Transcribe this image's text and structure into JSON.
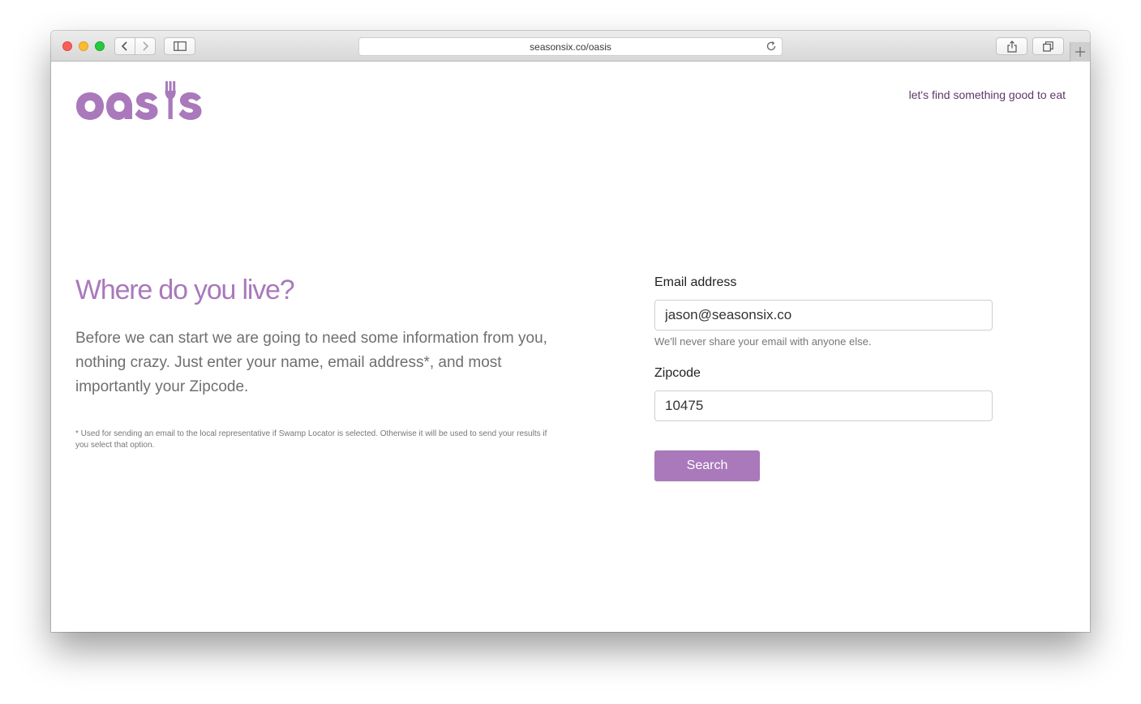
{
  "browser": {
    "url": "seasonsix.co/oasis"
  },
  "header": {
    "logo_text": "oasis",
    "tagline": "let's find something good to eat"
  },
  "main": {
    "heading": "Where do you live?",
    "intro": "Before we can start we are going to need some information from you, nothing crazy. Just enter your name, email address*, and most importantly your Zipcode.",
    "footnote": "* Used for sending an email to the local representative if Swamp Locator is selected. Otherwise it will be used to send your results if you select that option."
  },
  "form": {
    "email_label": "Email address",
    "email_value": "jason@seasonsix.co",
    "email_help": "We'll never share your email with anyone else.",
    "zip_label": "Zipcode",
    "zip_value": "10475",
    "search_label": "Search"
  },
  "colors": {
    "brand_purple": "#a979bc",
    "tagline_purple": "#5e3869"
  },
  "icons": {
    "back": "chevron-left-icon",
    "forward": "chevron-right-icon",
    "sidebar": "sidebar-icon",
    "reload": "reload-icon",
    "share": "share-icon",
    "tabs": "tabs-icon",
    "new_tab": "plus-icon"
  }
}
